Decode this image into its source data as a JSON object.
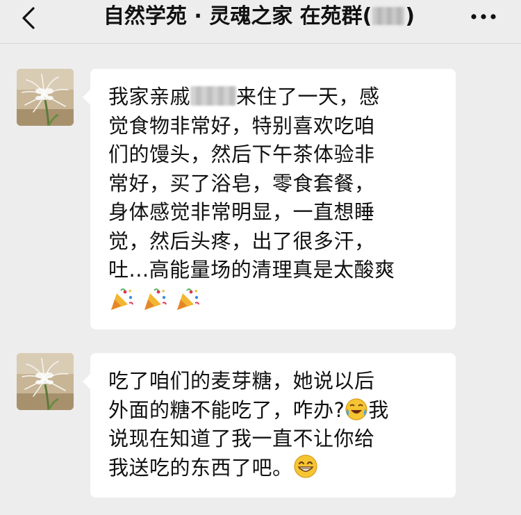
{
  "header": {
    "title_text": "自然学苑 · 灵魂之家 在苑群(",
    "title_close": ")"
  },
  "messages": [
    {
      "lines": [
        {
          "before": "我家亲戚",
          "after": "来住了一天，感"
        },
        {
          "text": "觉食物非常好，特别喜欢吃咱"
        },
        {
          "text": "们的馒头，然后下午茶体验非"
        },
        {
          "text": "常好，买了浴皂，零食套餐，"
        },
        {
          "text": "身体感觉非常明显，一直想睡"
        },
        {
          "text": "觉，然后头疼，出了很多汗，"
        },
        {
          "text": "吐...高能量场的清理真是太酸爽"
        }
      ],
      "emoji": [
        "party-popper-icon",
        "party-popper-icon",
        "party-popper-icon"
      ]
    },
    {
      "line1": "吃了咱们的麦芽糖，她说以后",
      "line2_before": "外面的糖不能吃了，咋办?",
      "line2_after": "我",
      "line3": "说现在知道了我一直不让你给",
      "line4": "我送吃的东西了吧。",
      "emoji": [
        "crying-laughing-face-icon",
        "grinning-face-icon"
      ]
    }
  ],
  "colors": {
    "background": "#ededed",
    "bubble": "#ffffff",
    "text": "#111111"
  }
}
